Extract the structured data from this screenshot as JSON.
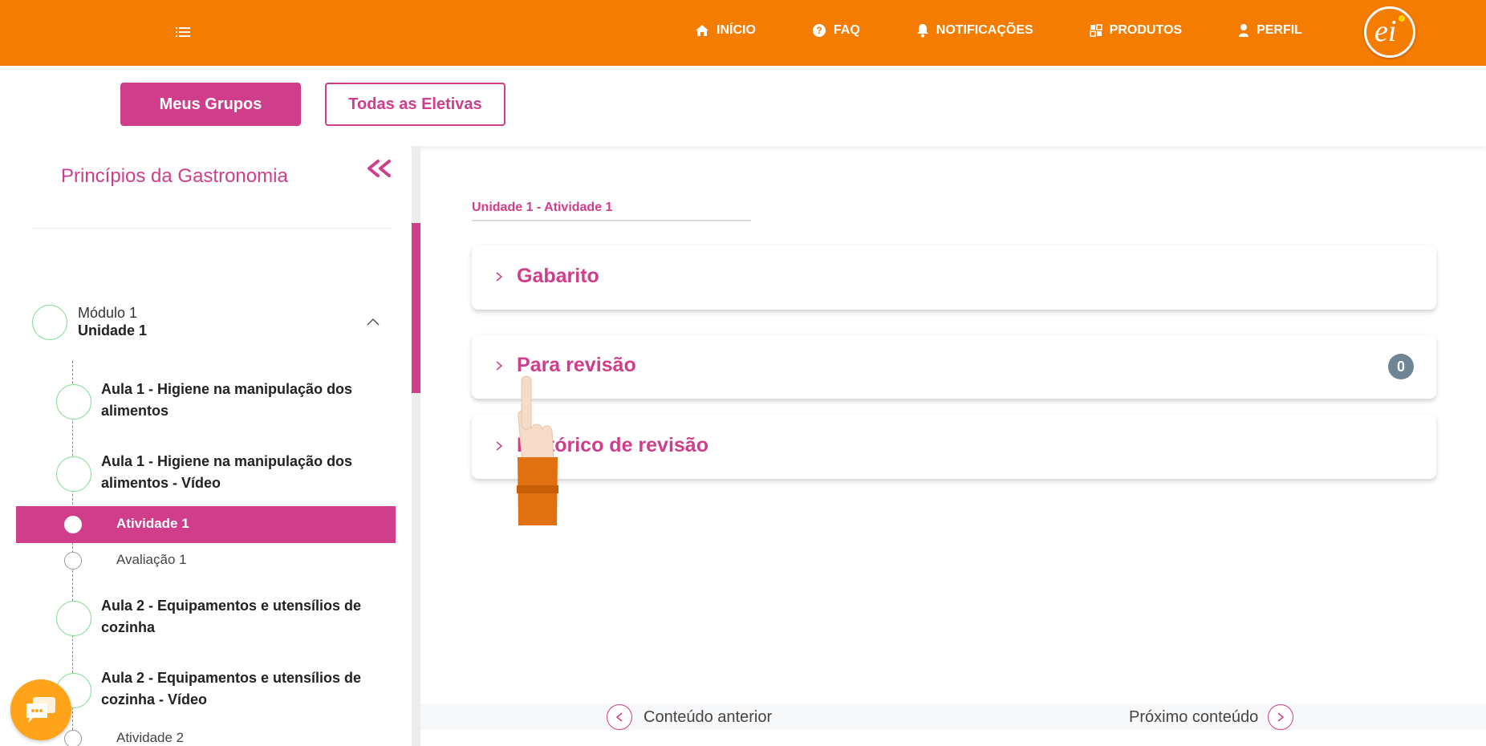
{
  "topbar": {
    "nav": [
      {
        "label": "INÍCIO",
        "icon": "home-icon"
      },
      {
        "label": "FAQ",
        "icon": "question-icon"
      },
      {
        "label": "NOTIFICAÇÕES",
        "icon": "bell-icon"
      },
      {
        "label": "PRODUTOS",
        "icon": "grid-icon"
      },
      {
        "label": "PERFIL",
        "icon": "user-icon"
      }
    ],
    "logo_text": "ei"
  },
  "groups": {
    "primary_label": "Meus Grupos",
    "secondary_label": "Todas as Eletivas"
  },
  "sidebar": {
    "course_title": "Princípios da Gastronomia",
    "module": {
      "label": "Módulo 1",
      "sub": "Unidade 1"
    },
    "lessons": [
      {
        "label": "Aula 1 - Higiene na manipulação dos alimentos"
      },
      {
        "label": "Aula 1 - Higiene na manipulação dos alimentos - Vídeo"
      },
      {
        "label": "Aula 2 - Equipamentos e utensílios de cozinha"
      },
      {
        "label": "Aula 2 - Equipamentos e utensílios de cozinha - Vídeo"
      }
    ],
    "sub_items": [
      {
        "label": "Atividade 1",
        "active": true
      },
      {
        "label": "Avaliação 1",
        "active": false
      },
      {
        "label": "Atividade 2",
        "active": false
      }
    ]
  },
  "main": {
    "breadcrumb": "Unidade 1 - Atividade 1",
    "accordions": [
      {
        "title": "Gabarito"
      },
      {
        "title": "Para revisão",
        "badge": "0"
      },
      {
        "title": "Histórico de revisão"
      }
    ],
    "prev_label": "Conteúdo anterior",
    "next_label": "Próximo conteúdo"
  },
  "colors": {
    "brand_orange": "#f47c00",
    "accent_pink": "#d03d8a",
    "progress_green": "#7ddc93",
    "badge_gray": "#6e8593",
    "chat_orange": "#ffa31a"
  }
}
